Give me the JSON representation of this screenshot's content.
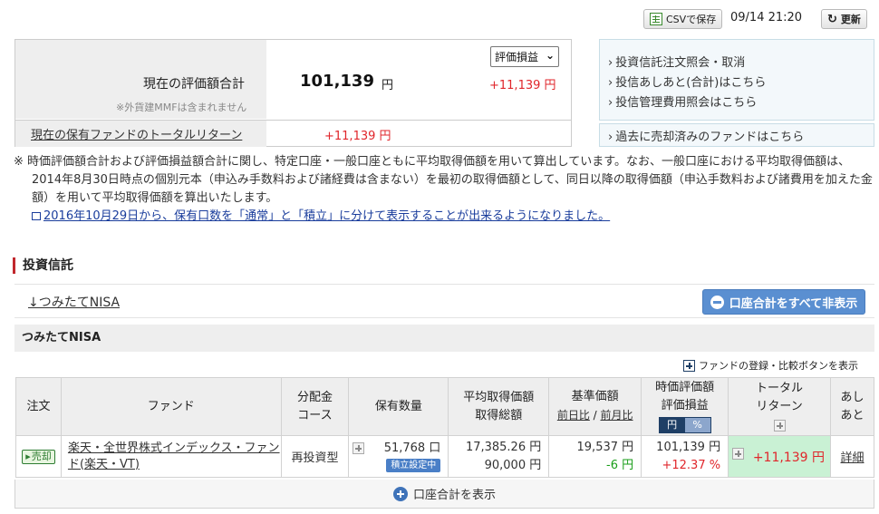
{
  "toolbar": {
    "csv_label": "CSVで保存",
    "timestamp": "09/14 21:20",
    "refresh_label": "更新"
  },
  "summary": {
    "valuation_label": "現在の評価額合計",
    "valuation_value": "101,139",
    "valuation_unit": "円",
    "mmf_note": "※外貨建MMFは含まれません",
    "select_value": "評価損益",
    "gain_value": "+11,139 円",
    "total_return_label": "現在の保有ファンドのトータルリターン",
    "total_return_value": "+11,139 円"
  },
  "links": {
    "order_inquiry": "投資信託注文照会・取消",
    "footsteps": "投信あしあと(合計)はこちら",
    "fee_inquiry": "投信管理費用照会はこちら",
    "sold_funds": "過去に売却済みのファンドはこちら"
  },
  "notes": {
    "main": "※ 時価評価額合計および評価損益額合計に関し、特定口座・一般口座ともに平均取得価額を用いて算出しています。なお、一般口座における平均取得価額は、2014年8月30日時点の個別元本（申込み手数料および諸経費は含まない）を最初の取得価額として、同日以降の取得価額（申込手数料および諸費用を加えた金額）を用いて平均取得価額を算出いたします。",
    "link": "2016年10月29日から、保有口数を「通常」と「積立」に分けて表示することが出来るようになりました。"
  },
  "section": {
    "title": "投資信託",
    "nisa_link": "↓つみたてNISA",
    "hide_all_button": "口座合計をすべて非表示",
    "group_title": "つみたてNISA",
    "register_compare": "ファンドの登録・比較ボタンを表示"
  },
  "table": {
    "headers": {
      "order": "注文",
      "fund": "ファンド",
      "dist_1": "分配金",
      "dist_2": "コース",
      "quantity": "保有数量",
      "avg_1": "平均取得価額",
      "avg_2": "取得総額",
      "base_1": "基準価額",
      "base_prev_day": "前日比",
      "base_sep": " / ",
      "base_prev_month": "前月比",
      "val_1": "時価評価額",
      "val_2": "評価損益",
      "toggle_yen": "円",
      "toggle_pct": "%",
      "total_1": "トータル",
      "total_2": "リターン",
      "ashi_1": "あし",
      "ashi_2": "あと"
    },
    "rows": [
      {
        "order_badge": "売却",
        "fund_name": "楽天・全世界株式インデックス・ファンド(楽天・VT)",
        "course": "再投資型",
        "quantity": "51,768 口",
        "tsumitate_badge": "積立設定中",
        "avg_price": "17,385.26 円",
        "total_cost": "90,000 円",
        "base_price": "19,537 円",
        "base_change": "-6 円",
        "market_value": "101,139 円",
        "gain_pct": "+12.37 %",
        "total_return": "+11,139 円",
        "detail": "詳細"
      }
    ],
    "show_total": "口座合計を表示"
  },
  "colors": {
    "accent_red": "#e0262b",
    "positive_green": "#1a9e1a",
    "button_blue": "#5a8fd1",
    "total_return_bg": "#c9f1d4"
  }
}
